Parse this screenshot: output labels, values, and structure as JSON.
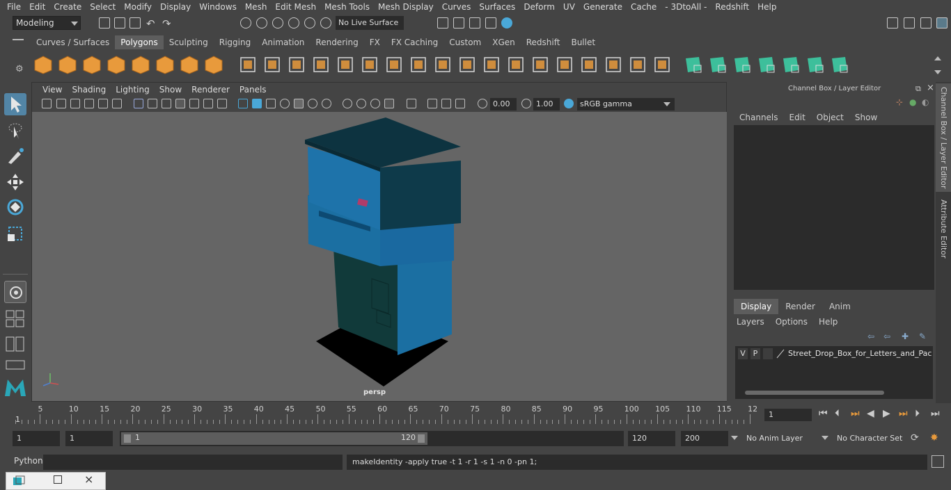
{
  "menubar": {
    "items": [
      "File",
      "Edit",
      "Create",
      "Select",
      "Modify",
      "Display",
      "Windows",
      "Mesh",
      "Edit Mesh",
      "Mesh Tools",
      "Mesh Display",
      "Curves",
      "Surfaces",
      "Deform",
      "UV",
      "Generate",
      "Cache",
      "- 3DtoAll -",
      "Redshift",
      "Help"
    ]
  },
  "statusline": {
    "mode": "Modeling",
    "live_surface": "No Live Surface"
  },
  "shelf": {
    "tabs": [
      "Curves / Surfaces",
      "Polygons",
      "Sculpting",
      "Rigging",
      "Animation",
      "Rendering",
      "FX",
      "FX Caching",
      "Custom",
      "XGen",
      "Redshift",
      "Bullet"
    ],
    "active": "Polygons"
  },
  "viewport": {
    "menu": [
      "View",
      "Shading",
      "Lighting",
      "Show",
      "Renderer",
      "Panels"
    ],
    "exposure": "0.00",
    "gamma": "1.00",
    "colorspace": "sRGB gamma",
    "camera": "persp"
  },
  "channelbox": {
    "title": "Channel Box / Layer Editor",
    "menu": [
      "Channels",
      "Edit",
      "Object",
      "Show"
    ],
    "tabs": [
      "Display",
      "Render",
      "Anim"
    ],
    "active_tab": "Display",
    "layer_menu": [
      "Layers",
      "Options",
      "Help"
    ],
    "layer": {
      "v": "V",
      "p": "P",
      "name": "Street_Drop_Box_for_Letters_and_Packag"
    }
  },
  "sidetabs": {
    "channel": "Channel Box / Layer Editor",
    "attribute": "Attribute Editor"
  },
  "timeline": {
    "ticks": [
      "5",
      "10",
      "15",
      "20",
      "25",
      "30",
      "35",
      "40",
      "45",
      "50",
      "55",
      "60",
      "65",
      "70",
      "75",
      "80",
      "85",
      "90",
      "95",
      "100",
      "105",
      "110",
      "115",
      "12"
    ],
    "start_marker": "1",
    "current_frame": "1"
  },
  "range": {
    "start": "1",
    "start2": "1",
    "slider_start": "1",
    "slider_end": "120",
    "end": "120",
    "end2": "200",
    "anim_layer": "No Anim Layer",
    "char_set": "No Character Set"
  },
  "cmdline": {
    "lang": "Python",
    "output": "makeIdentity -apply true -t 1 -r 1 -s 1 -n 0 -pn 1;"
  },
  "colors": {
    "bg": "#444444",
    "viewport": "#656565",
    "shelf_orange": "#e89a3c",
    "shelf_green": "#3dbf9b",
    "selected_blue": "#5285a6",
    "box_blue": "#1b6fa2"
  }
}
